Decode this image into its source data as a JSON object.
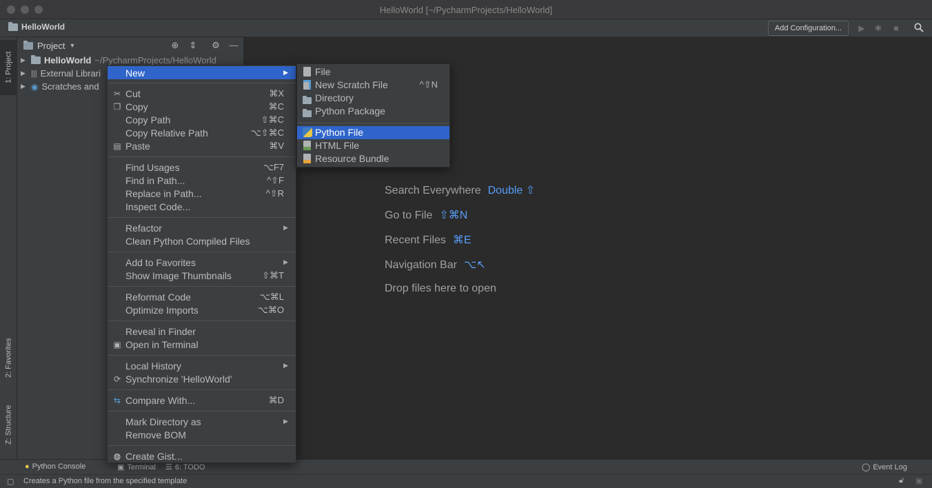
{
  "window": {
    "title": "HelloWorld [~/PycharmProjects/HelloWorld]",
    "project_name": "HelloWorld"
  },
  "toolbar": {
    "add_configuration": "Add Configuration..."
  },
  "left_stripe": {
    "project_tab": "1: Project",
    "favorites_tab": "2: Favorites",
    "structure_tab": "Z: Structure"
  },
  "project_panel": {
    "view_selector": "Project",
    "tree": [
      {
        "name": "HelloWorld",
        "path": "~/PycharmProjects/HelloWorld"
      },
      {
        "name": "External Librari"
      },
      {
        "name": "Scratches and"
      }
    ]
  },
  "editor_hints": [
    {
      "text": "Search Everywhere",
      "key": "Double ⇧"
    },
    {
      "text": "Go to File",
      "key": "⇧⌘N"
    },
    {
      "text": "Recent Files",
      "key": "⌘E"
    },
    {
      "text": "Navigation Bar",
      "key": "⌥↖"
    },
    {
      "text": "Drop files here to open",
      "key": ""
    }
  ],
  "context_menu": {
    "items": [
      {
        "label": "New",
        "shortcut": "",
        "submenu": true
      },
      {
        "label": "Cut",
        "shortcut": "⌘X",
        "icon": "scissors-icon"
      },
      {
        "label": "Copy",
        "shortcut": "⌘C",
        "icon": "copy-icon"
      },
      {
        "label": "Copy Path",
        "shortcut": "⇧⌘C"
      },
      {
        "label": "Copy Relative Path",
        "shortcut": "⌥⇧⌘C"
      },
      {
        "label": "Paste",
        "shortcut": "⌘V",
        "icon": "clipboard-icon"
      },
      {
        "label": "Find Usages",
        "shortcut": "⌥F7"
      },
      {
        "label": "Find in Path...",
        "shortcut": "^⇧F"
      },
      {
        "label": "Replace in Path...",
        "shortcut": "^⇧R"
      },
      {
        "label": "Inspect Code...",
        "shortcut": ""
      },
      {
        "label": "Refactor",
        "shortcut": "",
        "submenu": true
      },
      {
        "label": "Clean Python Compiled Files",
        "shortcut": ""
      },
      {
        "label": "Add to Favorites",
        "shortcut": "",
        "submenu": true
      },
      {
        "label": "Show Image Thumbnails",
        "shortcut": "⇧⌘T"
      },
      {
        "label": "Reformat Code",
        "shortcut": "⌥⌘L"
      },
      {
        "label": "Optimize Imports",
        "shortcut": "⌥⌘O"
      },
      {
        "label": "Reveal in Finder",
        "shortcut": ""
      },
      {
        "label": "Open in Terminal",
        "shortcut": "",
        "icon": "terminal-icon"
      },
      {
        "label": "Local History",
        "shortcut": "",
        "submenu": true
      },
      {
        "label": "Synchronize 'HelloWorld'",
        "shortcut": "",
        "icon": "sync-icon"
      },
      {
        "label": "Compare With...",
        "shortcut": "⌘D",
        "icon": "compare-icon"
      },
      {
        "label": "Mark Directory as",
        "shortcut": "",
        "submenu": true
      },
      {
        "label": "Remove BOM",
        "shortcut": ""
      },
      {
        "label": "Create Gist...",
        "shortcut": "",
        "icon": "github-icon"
      }
    ]
  },
  "new_submenu": {
    "items": [
      {
        "label": "File",
        "shortcut": ""
      },
      {
        "label": "New Scratch File",
        "shortcut": "^⇧N"
      },
      {
        "label": "Directory",
        "shortcut": ""
      },
      {
        "label": "Python Package",
        "shortcut": ""
      },
      {
        "label": "Python File",
        "shortcut": ""
      },
      {
        "label": "HTML File",
        "shortcut": ""
      },
      {
        "label": "Resource Bundle",
        "shortcut": ""
      }
    ]
  },
  "bottom_tabs": {
    "python_console": "Python Console",
    "terminal": "Terminal",
    "todo": "6: TODO",
    "event_log": "Event Log"
  },
  "status": {
    "message": "Creates a Python file from the specified template"
  },
  "colors": {
    "selection": "#2f65ca",
    "hint_key": "#589df6"
  }
}
